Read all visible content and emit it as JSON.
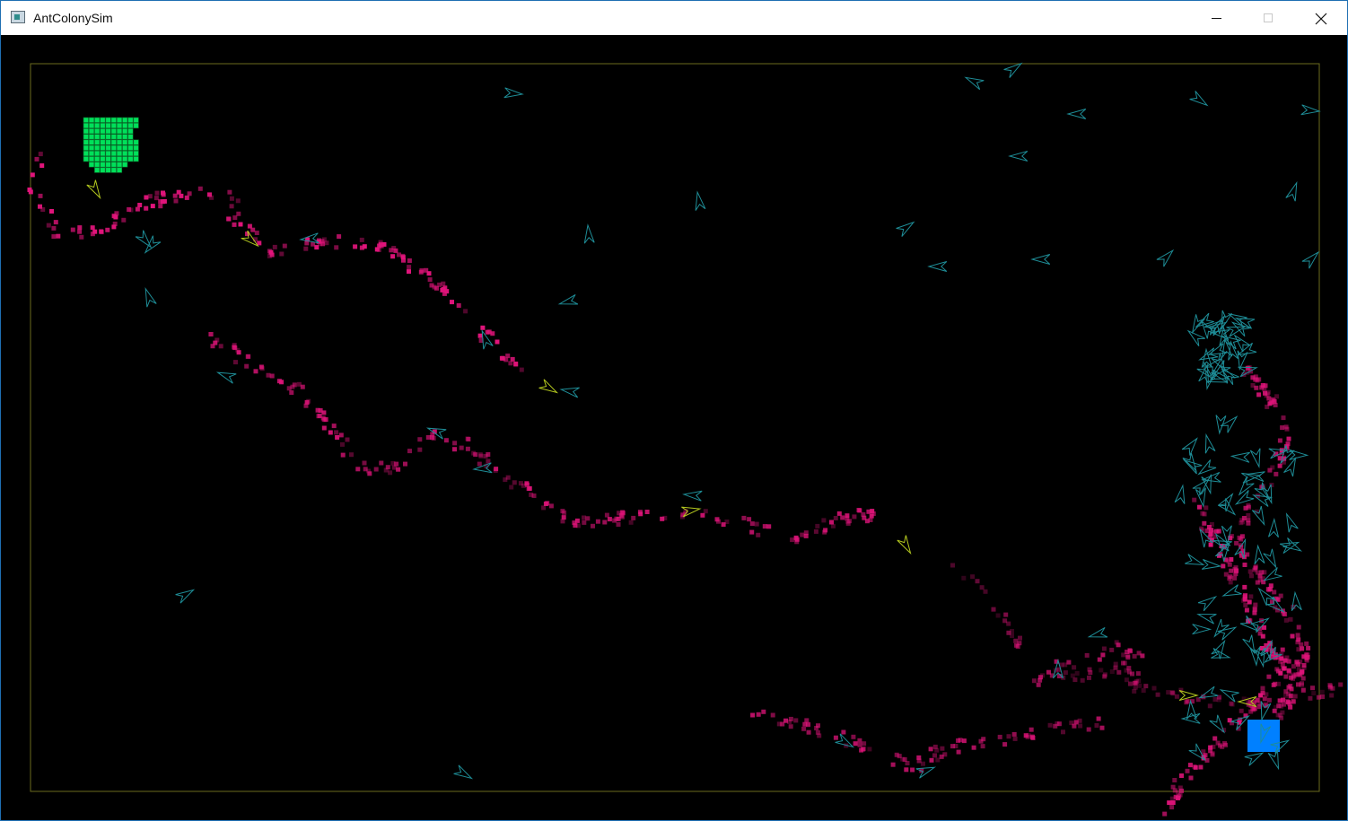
{
  "window": {
    "title": "AntColonySim",
    "app_icon": "application-icon",
    "controls": [
      {
        "name": "minimize",
        "icon": "minimize-icon"
      },
      {
        "name": "maximize",
        "icon": "maximize-icon"
      },
      {
        "name": "close",
        "icon": "close-icon"
      }
    ]
  },
  "simulation": {
    "colors": {
      "background": "#000000",
      "boundary": "#6b6b1e",
      "food": "#00e05a",
      "food_grid": "#0a6a2a",
      "nest": "#0080ff",
      "pheromone": "#e0147a",
      "ant_searching": "#1e8c96",
      "ant_returning": "#b4c81e"
    }
  }
}
